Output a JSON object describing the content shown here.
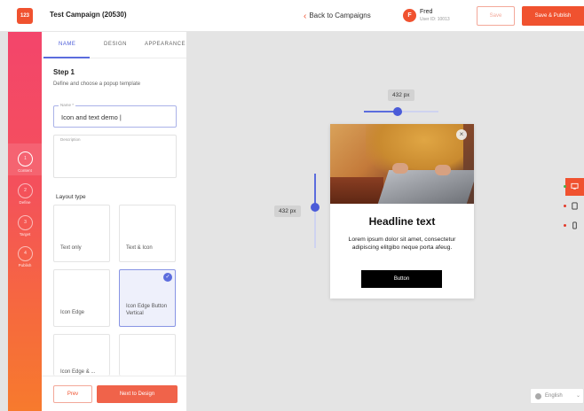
{
  "header": {
    "logo_text": "123",
    "campaign_title": "Test Campaign (20530)",
    "back_label": "Back to Campaigns",
    "user_initial": "F",
    "user_name": "Fred",
    "user_id": "User ID: 10013",
    "save_label": "Save",
    "publish_label": "Save & Publish"
  },
  "steps": [
    {
      "number": "1",
      "label": "Content"
    },
    {
      "number": "2",
      "label": "Define"
    },
    {
      "number": "3",
      "label": "Target"
    },
    {
      "number": "4",
      "label": "Publish"
    }
  ],
  "tabs": [
    {
      "label": "NAME"
    },
    {
      "label": "DESIGN"
    },
    {
      "label": "APPEARANCE"
    }
  ],
  "form": {
    "step_title": "Step 1",
    "step_desc": "Define and choose a popup template",
    "name_label": "Name *",
    "name_value": "Icon and text demo",
    "description_label": "Description",
    "layout_title": "Layout type"
  },
  "layouts": [
    {
      "label": "Text only"
    },
    {
      "label": "Text & Icon"
    },
    {
      "label": "Icon Edge"
    },
    {
      "label": "Icon Edge Button Vertical"
    },
    {
      "label": "Icon Edge & ..."
    },
    {
      "label": ""
    }
  ],
  "footer": {
    "prev_label": "Prev",
    "next_label": "Next to Design"
  },
  "canvas": {
    "width_label": "432 px",
    "height_label": "432 px",
    "width_slider_value": 0.45,
    "height_slider_value": 0.45
  },
  "popup": {
    "headline": "Headline text",
    "body": "Lorem ipsum dolor sit amet, consectetur adipiscing elitgibo neque porta afeug.",
    "button_label": "Button",
    "close_glyph": "×"
  },
  "devices": [
    {
      "name": "desktop",
      "active": true
    },
    {
      "name": "tablet",
      "active": false
    },
    {
      "name": "mobile",
      "active": false
    }
  ],
  "language": {
    "label": "English"
  },
  "colors": {
    "accent": "#f0522f",
    "selection": "#5b6cdd"
  }
}
